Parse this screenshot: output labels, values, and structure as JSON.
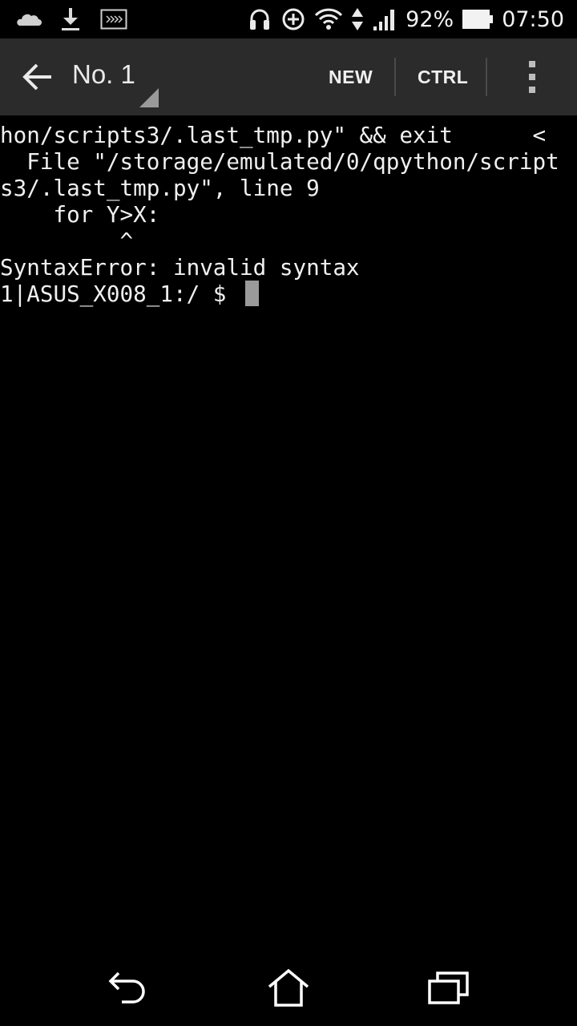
{
  "status_bar": {
    "battery_percent": "92%",
    "time": "07:50",
    "left_icons": [
      "cloud-icon",
      "download-icon",
      "keyboard-icon"
    ],
    "right_icons": [
      "headset-icon",
      "data-saver-icon",
      "wifi-icon",
      "data-transfer-icon",
      "signal-icon",
      "battery-icon"
    ]
  },
  "action_bar": {
    "title": "No. 1",
    "new_label": "NEW",
    "ctrl_label": "CTRL",
    "icons": [
      "back-arrow-icon",
      "spinner-dropdown-icon",
      "overflow-menu-icon"
    ]
  },
  "terminal": {
    "lines": [
      "hon/scripts3/.last_tmp.py\" && exit      <",
      "  File \"/storage/emulated/0/qpython/script",
      "s3/.last_tmp.py\", line 9",
      "    for Y>X:",
      "         ^",
      "SyntaxError: invalid syntax",
      "1|ASUS_X008_1:/ $ "
    ]
  },
  "nav_bar": {
    "icons": [
      "back-icon",
      "home-icon",
      "recent-apps-icon"
    ]
  },
  "colors": {
    "status_bar_bg": "#000000",
    "action_bar_bg": "#2b2b2b",
    "terminal_bg": "#000000",
    "terminal_text": "#f0f0f0",
    "cursor": "#9a9a9a"
  }
}
